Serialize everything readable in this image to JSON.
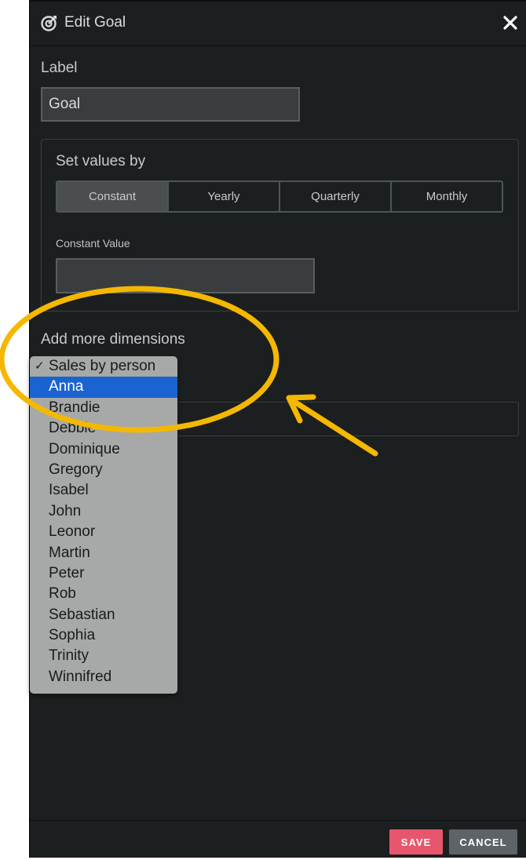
{
  "dialog": {
    "title": "Edit Goal",
    "close_icon": "close-icon",
    "title_icon": "goal-target-icon"
  },
  "label_section": {
    "label": "Label",
    "value": "Goal"
  },
  "values_section": {
    "heading": "Set values by",
    "options": [
      "Constant",
      "Yearly",
      "Quarterly",
      "Monthly"
    ],
    "selected": "Constant",
    "constant_label": "Constant Value",
    "constant_value": ""
  },
  "dimensions": {
    "heading": "Add more dimensions",
    "dropdown": {
      "selected": "Sales by person",
      "highlighted": "Anna",
      "options": [
        "Anna",
        "Brandie",
        "Debbie",
        "Dominique",
        "Gregory",
        "Isabel",
        "John",
        "Leonor",
        "Martin",
        "Peter",
        "Rob",
        "Sebastian",
        "Sophia",
        "Trinity",
        "Winnifred"
      ]
    }
  },
  "footer": {
    "save_label": "SAVE",
    "cancel_label": "CANCEL"
  },
  "colors": {
    "panel_bg": "#1c1f20",
    "save": "#e8566e",
    "cancel": "#5d6366",
    "highlight": "#1a63d0",
    "annotation": "#f5b800"
  }
}
